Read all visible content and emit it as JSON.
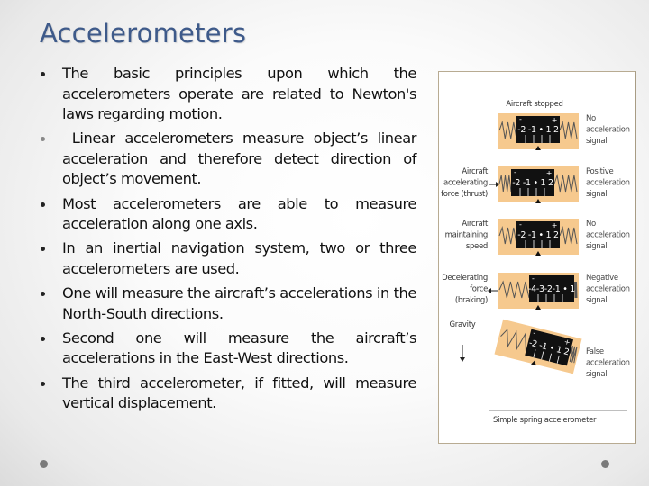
{
  "slide": {
    "title": "Accelerometers",
    "bullets": [
      {
        "text": "The basic principles upon which the accelerometers operate are related to Newton's laws regarding motion.",
        "muted_bullet": false
      },
      {
        "text": " Linear accelerometers measure object’s linear acceleration and therefore detect direction of object’s movement.",
        "muted_bullet": true
      },
      {
        "text": "Most accelerometers are able to measure acceleration along one axis.",
        "muted_bullet": false
      },
      {
        "text": "In an inertial navigation system, two or three accelerometers are used.",
        "muted_bullet": false
      },
      {
        "text": "One will measure the aircraft’s accelerations in the North-South directions.",
        "muted_bullet": false
      },
      {
        "text": "Second one will measure the aircraft’s accelerations in the East-West directions.",
        "muted_bullet": false
      },
      {
        "text": "The third accelerometer, if fitted, will measure vertical displacement.",
        "muted_bullet": false
      }
    ]
  },
  "figure": {
    "caption": "Simple spring accelerometer",
    "panels": [
      {
        "left_label": [
          "Aircraft stopped"
        ],
        "scale": "-2 -1 • 1 2",
        "right_label": [
          "No",
          "acceleration",
          "signal"
        ],
        "arrow": "none"
      },
      {
        "left_label": [
          "Aircraft",
          "accelerating",
          "force (thrust)"
        ],
        "scale": "-2 -1 • 1 2",
        "right_label": [
          "Positive",
          "acceleration",
          "signal"
        ],
        "arrow": "right"
      },
      {
        "left_label": [
          "Aircraft",
          "maintaining",
          "speed"
        ],
        "scale": "-2 -1 • 1 2",
        "right_label": [
          "No",
          "acceleration",
          "signal"
        ],
        "arrow": "none"
      },
      {
        "left_label": [
          "Decelerating",
          "force",
          "(braking)"
        ],
        "scale": "-4-3-2-1 • 1",
        "right_label": [
          "Negative",
          "acceleration",
          "signal"
        ],
        "arrow": "left"
      },
      {
        "left_label": [
          "Gravity"
        ],
        "scale": "-2 -1 • 1 2",
        "right_label": [
          "False",
          "acceleration",
          "signal"
        ],
        "arrow": "down"
      }
    ],
    "scale_signs": {
      "minus": "-",
      "plus": "+"
    },
    "colors": {
      "meter_bg": "#f6c98e",
      "scale_bg": "#111111",
      "spring": "#555555"
    }
  },
  "theme": {
    "title_color": "#3e5a8a"
  }
}
